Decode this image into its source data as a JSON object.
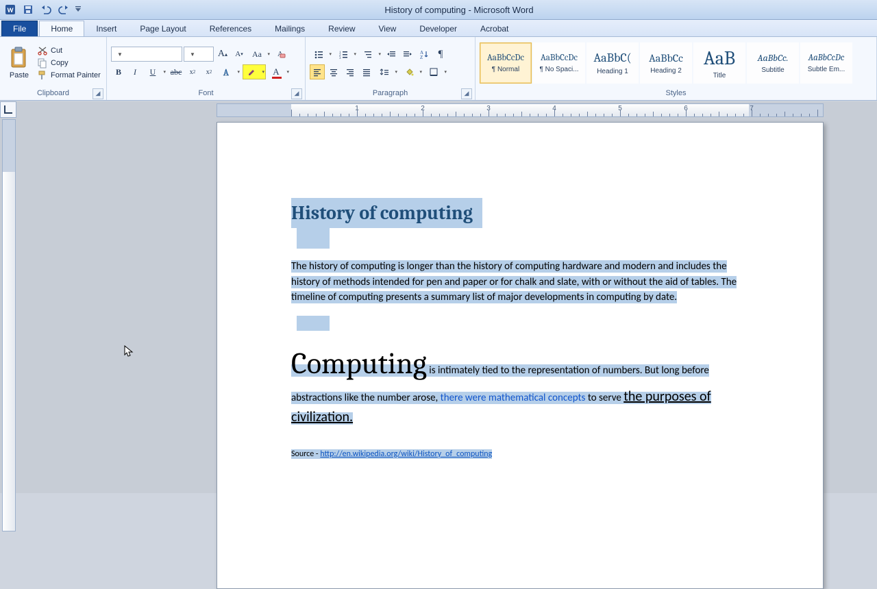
{
  "window": {
    "title": "History of computing  -  Microsoft Word"
  },
  "tabs": {
    "file": "File",
    "items": [
      "Home",
      "Insert",
      "Page Layout",
      "References",
      "Mailings",
      "Review",
      "View",
      "Developer",
      "Acrobat"
    ],
    "active": 0
  },
  "clipboard": {
    "paste": "Paste",
    "cut": "Cut",
    "copy": "Copy",
    "format_painter": "Format Painter",
    "label": "Clipboard"
  },
  "font_group": {
    "font_name": "",
    "font_size": "",
    "label": "Font"
  },
  "paragraph_group": {
    "label": "Paragraph"
  },
  "styles_group": {
    "label": "Styles",
    "tiles": [
      {
        "sample": "AaBbCcDc",
        "name": "¶ Normal",
        "active": true,
        "fs": "13px",
        "it": false
      },
      {
        "sample": "AaBbCcDc",
        "name": "¶ No Spaci...",
        "fs": "13px",
        "it": false
      },
      {
        "sample": "AaBbC(",
        "name": "Heading 1",
        "fs": "18px",
        "it": false
      },
      {
        "sample": "AaBbCc",
        "name": "Heading 2",
        "fs": "16px",
        "it": false
      },
      {
        "sample": "AaB",
        "name": "Title",
        "fs": "28px",
        "it": false
      },
      {
        "sample": "AaBbCc.",
        "name": "Subtitle",
        "fs": "14px",
        "it": true
      },
      {
        "sample": "AaBbCcDc",
        "name": "Subtle Em...",
        "fs": "13px",
        "it": true
      }
    ]
  },
  "document": {
    "title": "History of computing",
    "p1": "The history of computing is longer than the history of computing hardware and modern and includes the history of methods intended for pen and paper or for chalk and slate, with or without the aid of tables. The timeline of computing presents a summary list of major developments in computing by date.",
    "p2_lead": "Computing",
    "p2_a": " is intimately tied to the representation of numbers. But long before abstractions like the number arose, ",
    "p2_link1": "there were mathematical concepts",
    "p2_b": " to serve ",
    "p2_link2": "the purposes of civilization.",
    "src_label": "Source - ",
    "src_url_text": "http://en.wikipedia.org/wiki/History_of_computing"
  }
}
